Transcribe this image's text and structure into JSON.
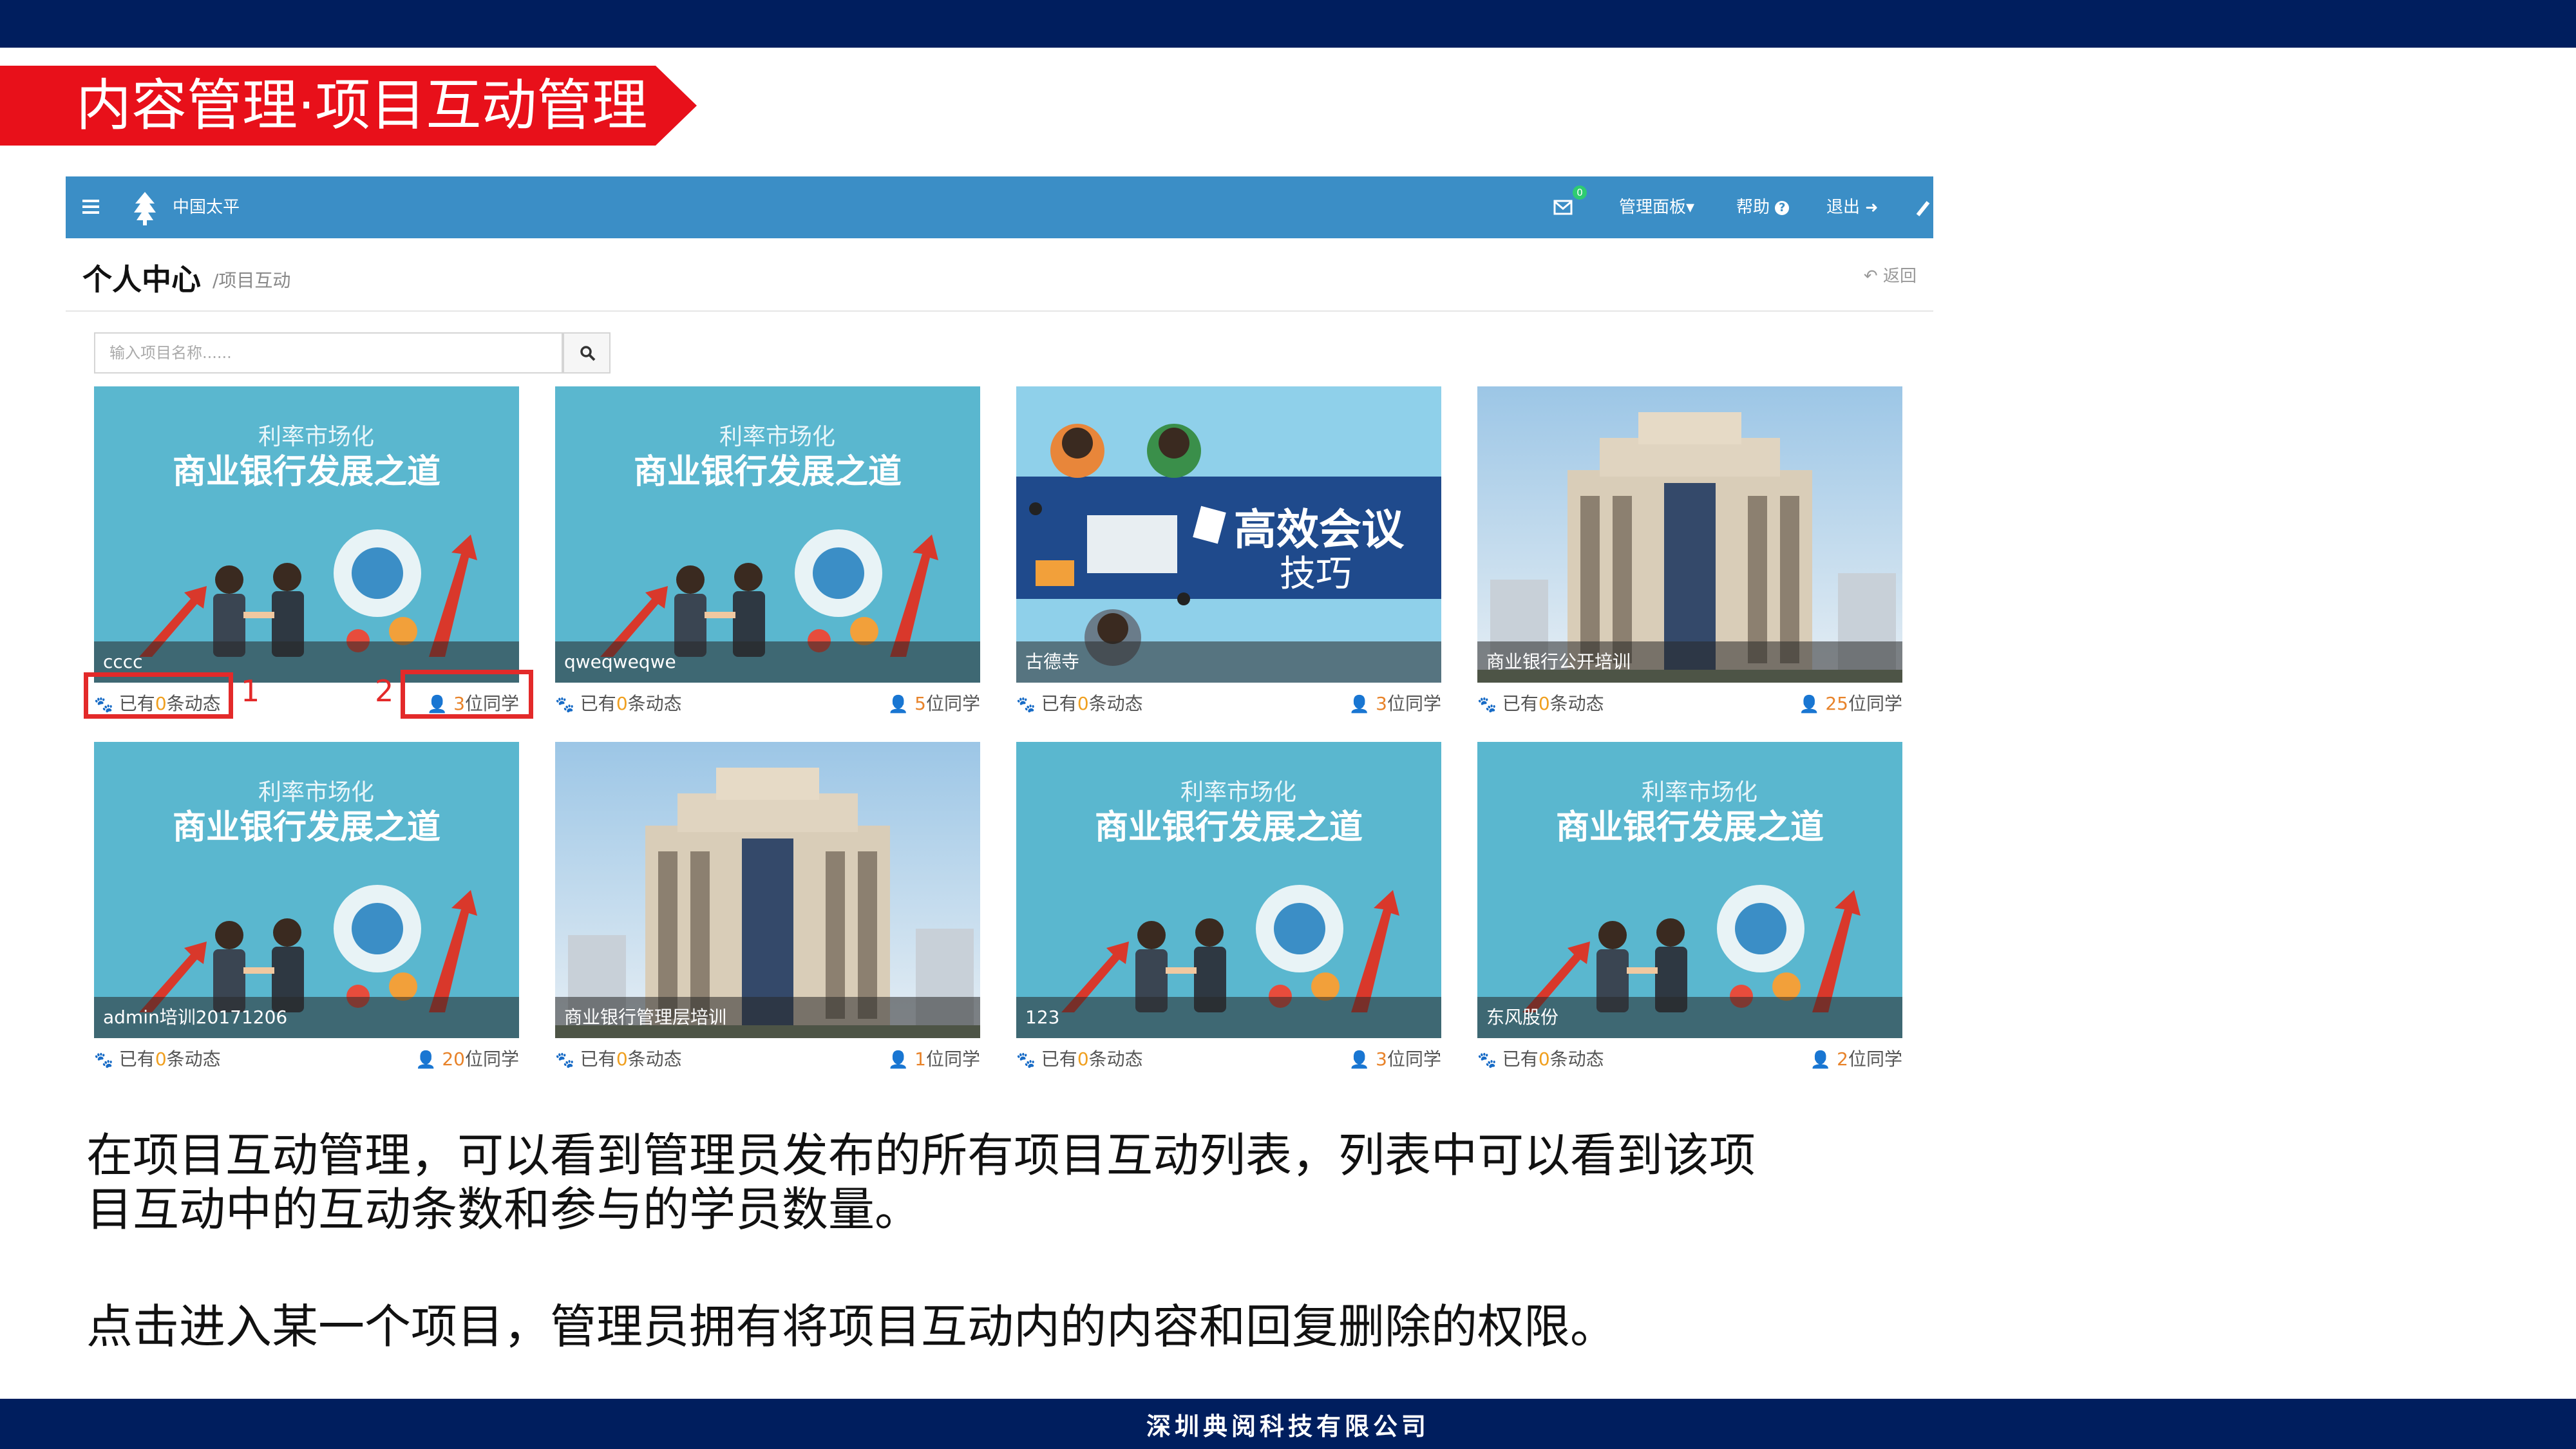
{
  "slide": {
    "title": "内容管理·项目互动管理",
    "footer": "深圳典阅科技有限公司",
    "paragraphs": [
      "在项目互动管理，可以看到管理员发布的所有项目互动列表，列表中可以看到该项",
      "目互动中的互动条数和参与的学员数量。",
      "点击进入某一个项目，管理员拥有将项目互动内的内容和回复删除的权限。"
    ]
  },
  "navbar": {
    "brand": "中国太平",
    "mail_badge": "0",
    "dashboard": "管理面板▾",
    "help": "帮助",
    "logout": "退出"
  },
  "header": {
    "title": "个人中心",
    "breadcrumb": "/项目互动",
    "back": "返回"
  },
  "search": {
    "placeholder": "输入项目名称......"
  },
  "banner": {
    "line1": "利率市场化",
    "line2": "商业银行发展之道",
    "meeting1": "高效会议",
    "meeting2": "技巧"
  },
  "cards": [
    {
      "name": "cccc",
      "dyn_pre": "已有",
      "dyn_zero": "0",
      "dyn_post": "条动态",
      "stu_num": "3",
      "stu_post": "位同学",
      "image": "bank"
    },
    {
      "name": "qweqweqwe",
      "dyn_pre": "已有",
      "dyn_zero": "0",
      "dyn_post": "条动态",
      "stu_num": "5",
      "stu_post": "位同学",
      "image": "bank"
    },
    {
      "name": "古德寺",
      "dyn_pre": "已有",
      "dyn_zero": "0",
      "dyn_post": "条动态",
      "stu_num": "3",
      "stu_post": "位同学",
      "image": "meeting"
    },
    {
      "name": "商业银行公开培训",
      "dyn_pre": "已有",
      "dyn_zero": "0",
      "dyn_post": "条动态",
      "stu_num": "25",
      "stu_post": "位同学",
      "image": "building"
    },
    {
      "name": "admin培训20171206",
      "dyn_pre": "已有",
      "dyn_zero": "0",
      "dyn_post": "条动态",
      "stu_num": "20",
      "stu_post": "位同学",
      "image": "bank"
    },
    {
      "name": "商业银行管理层培训",
      "dyn_pre": "已有",
      "dyn_zero": "0",
      "dyn_post": "条动态",
      "stu_num": "1",
      "stu_post": "位同学",
      "image": "building"
    },
    {
      "name": "123",
      "dyn_pre": "已有",
      "dyn_zero": "0",
      "dyn_post": "条动态",
      "stu_num": "3",
      "stu_post": "位同学",
      "image": "bank"
    },
    {
      "name": "东风股份",
      "dyn_pre": "已有",
      "dyn_zero": "0",
      "dyn_post": "条动态",
      "stu_num": "2",
      "stu_post": "位同学",
      "image": "bank"
    }
  ],
  "annotations": [
    "1",
    "2"
  ],
  "colors": {
    "slide_bar": "#001e5e",
    "title_tag": "#e8101a",
    "navbar": "#3b8ec6",
    "highlight": "#e32a2a",
    "card_teal": "#5ab7cf"
  }
}
